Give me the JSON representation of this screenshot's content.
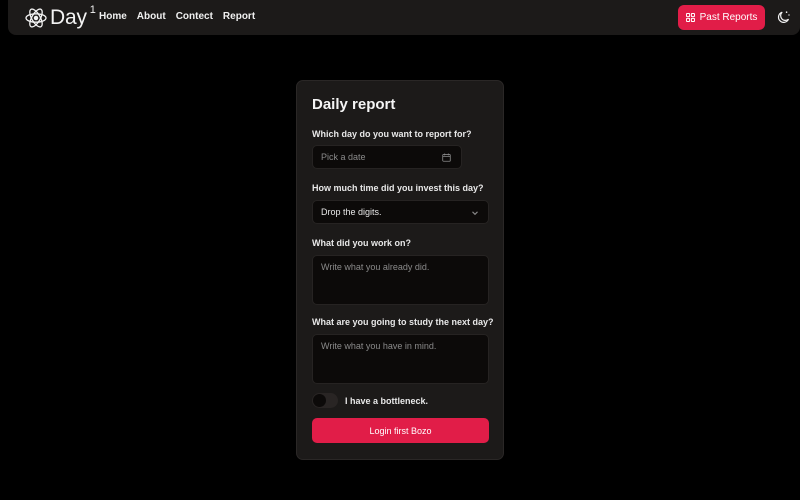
{
  "header": {
    "logo_text": "Day",
    "logo_sup": "1",
    "nav": [
      "Home",
      "About",
      "Contect",
      "Report"
    ],
    "past_reports_label": "Past Reports",
    "accent_color": "#e11d48"
  },
  "form": {
    "title": "Daily report",
    "date_label": "Which day do you want to report for?",
    "date_placeholder": "Pick a date",
    "time_label": "How much time did you invest this day?",
    "time_select_value": "Drop the digits.",
    "work_label": "What did you work on?",
    "work_placeholder": "Write what you already did.",
    "next_label": "What are you going to study the next day?",
    "next_placeholder": "Write what you have in mind.",
    "bottleneck_label": "I have a bottleneck.",
    "bottleneck_checked": false,
    "submit_label": "Login first Bozo"
  }
}
